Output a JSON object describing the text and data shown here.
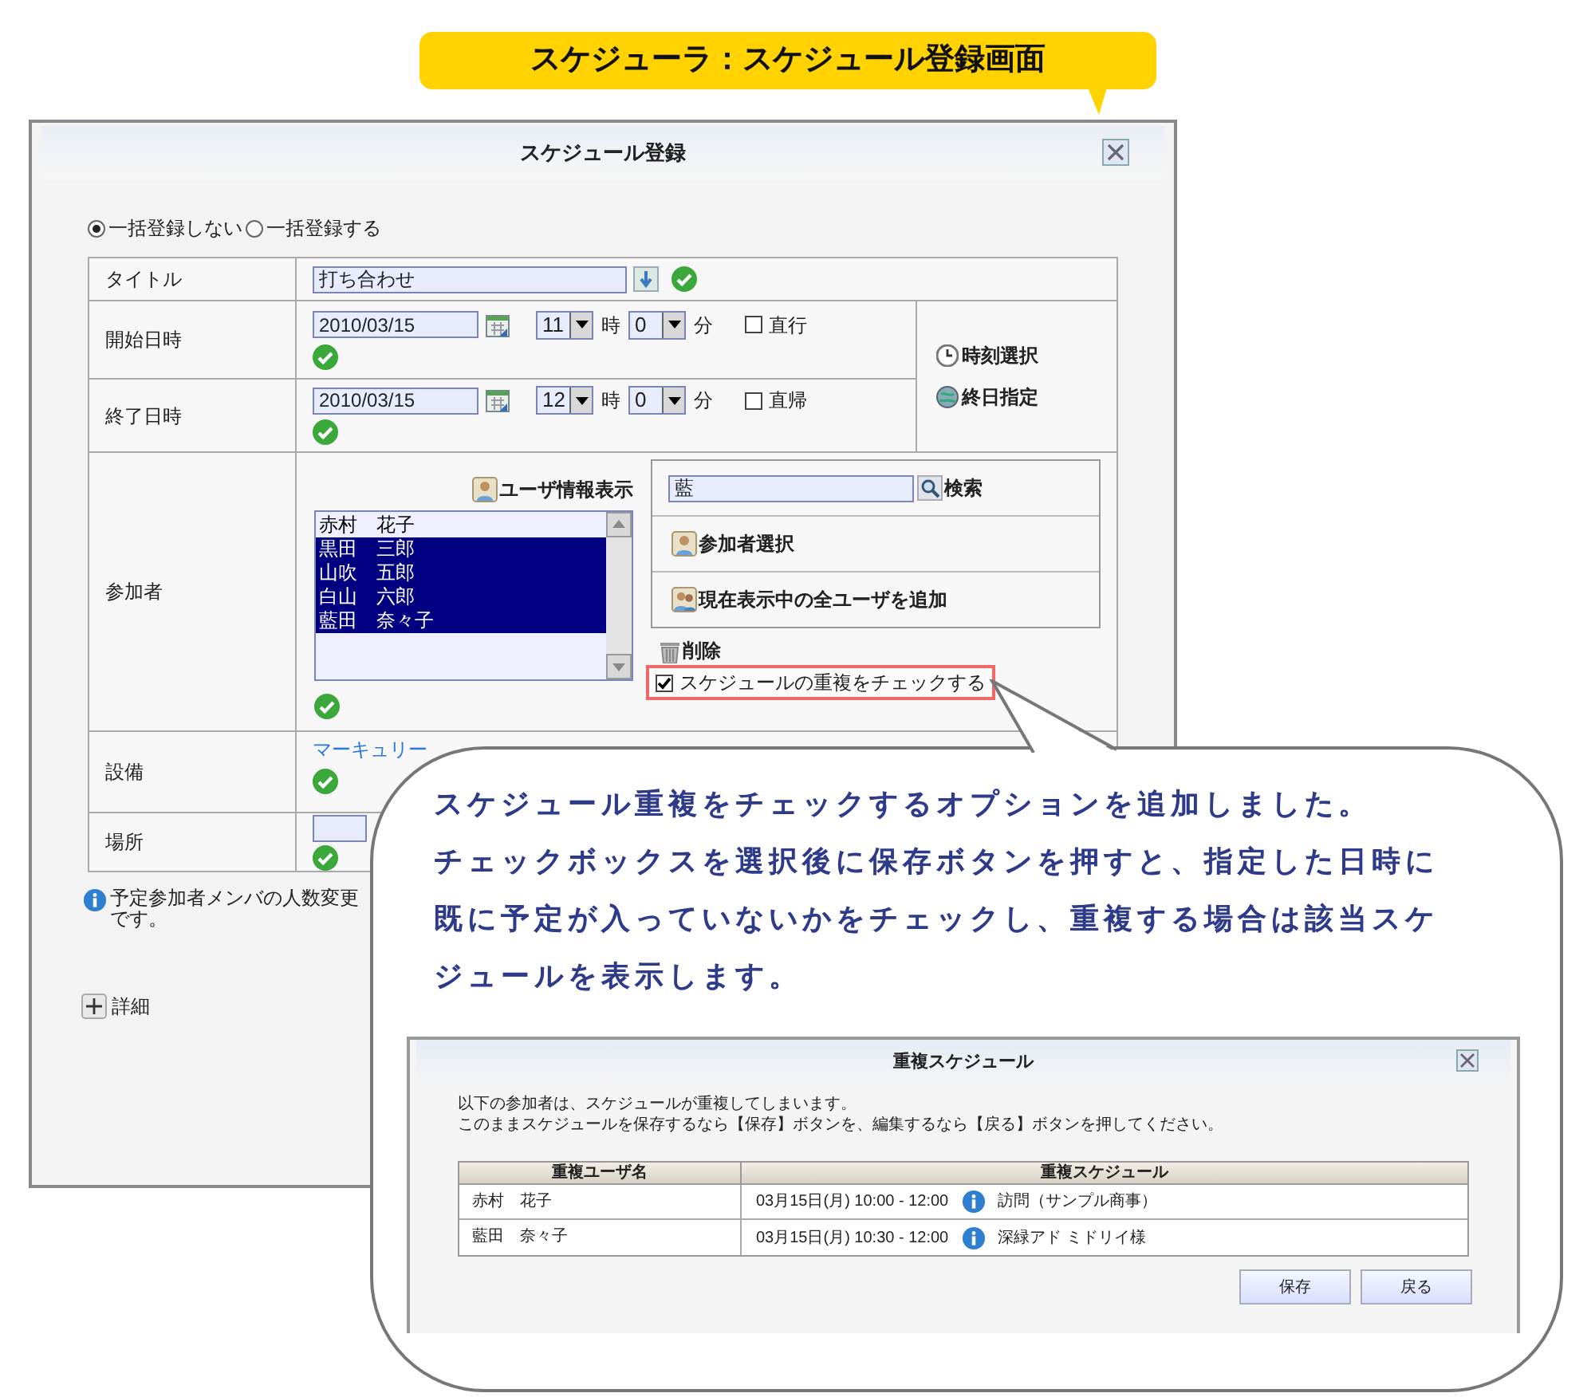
{
  "banner": {
    "text": "スケジューラ：スケジュール登録画面"
  },
  "dialog": {
    "title": "スケジュール登録",
    "bulk_options": [
      {
        "label": "一括登録しない",
        "selected": true
      },
      {
        "label": "一括登録する",
        "selected": false
      }
    ],
    "form": {
      "title_row": {
        "label": "タイトル",
        "value": "打ち合わせ"
      },
      "start": {
        "label": "開始日時",
        "date": "2010/03/15",
        "hour": "11",
        "hour_unit": "時",
        "minute": "0",
        "minute_unit": "分",
        "option": {
          "label": "直行",
          "checked": false
        }
      },
      "end": {
        "label": "終了日時",
        "date": "2010/03/15",
        "hour": "12",
        "hour_unit": "時",
        "minute": "0",
        "minute_unit": "分",
        "option": {
          "label": "直帰",
          "checked": false
        }
      },
      "time_buttons": [
        "時刻選択",
        "終日指定"
      ],
      "participants": {
        "label": "参加者",
        "user_info": "ユーザ情報表示",
        "members": [
          {
            "name": "赤村　花子",
            "selected": false
          },
          {
            "name": "黒田　三郎",
            "selected": true
          },
          {
            "name": "山吹　五郎",
            "selected": true
          },
          {
            "name": "白山　六郎",
            "selected": true
          },
          {
            "name": "藍田　奈々子",
            "selected": true
          }
        ],
        "search_value": "藍",
        "search": "検索",
        "select": "参加者選択",
        "add_all": "現在表示中の全ユーザを追加",
        "delete": "削除",
        "overlap_check": {
          "label": "スケジュールの重複をチェックする",
          "checked": true
        }
      },
      "equipment": {
        "label": "設備",
        "value": "マーキュリー"
      },
      "place": {
        "label": "場所"
      }
    },
    "note": {
      "line_1": "予定参加者メンバの人数変更",
      "line_2": "です。"
    },
    "details": "詳細"
  },
  "callout": {
    "paragraphs": [
      "スケジュール重複をチェックするオプションを追加しました。",
      "チェックボックスを選択後に保存ボタンを押すと、指定した日時に既に予定が入っていないかをチェックし、重複する場合は該当スケジュールを表示します。"
    ],
    "dialog": {
      "title": "重複スケジュール",
      "message": [
        "以下の参加者は、スケジュールが重複してしまいます。",
        "このままスケジュールを保存するなら【保存】ボタンを、編集するなら【戻る】ボタンを押してください。"
      ],
      "columns": [
        "重複ユーザ名",
        "重複スケジュール"
      ],
      "rows": [
        {
          "user": "赤村　花子",
          "time": "03月15日(月) 10:00 - 12:00",
          "subject": "訪問（サンプル商事）"
        },
        {
          "user": "藍田　奈々子",
          "time": "03月15日(月) 10:30 - 12:00",
          "subject": "深緑アド ミドリイ様"
        }
      ],
      "buttons": [
        "保存",
        "戻る"
      ]
    }
  }
}
